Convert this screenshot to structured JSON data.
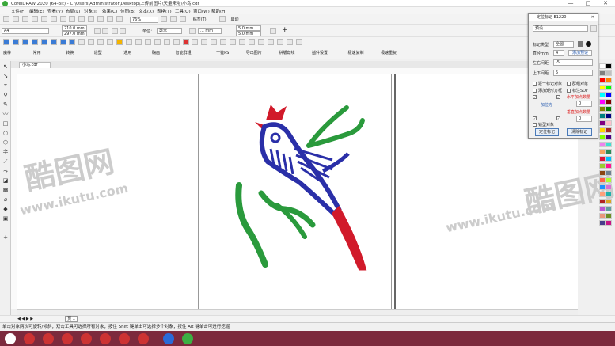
{
  "window": {
    "title": "CorelDRAW 2020 (64-Bit) - C:\\Users\\Administrator\\Desktop\\上传前图片\\矢量来啦\\小鸟.cdr",
    "controls": [
      "—",
      "□",
      "✕"
    ]
  },
  "menu": [
    "文件(F)",
    "编辑(E)",
    "查看(V)",
    "布局(L)",
    "对象(J)",
    "效果(C)",
    "位图(B)",
    "文本(X)",
    "表格(T)",
    "工具(O)",
    "窗口(W)",
    "帮助(H)"
  ],
  "toolbar1": {
    "zoom": "76%",
    "snap_label": "贴齐(T)",
    "launch_label": "启动"
  },
  "toolbar2": {
    "page_size": "A4",
    "width": "210.0 mm",
    "height": "297.0 mm",
    "units_label": "单位：",
    "units": "毫米",
    "nudge": ".1 mm",
    "dup_x": "5.0 mm",
    "dup_y": "5.0 mm"
  },
  "toolbar4": [
    "魔棒",
    "常用",
    "转换",
    "造型",
    "通用",
    "确画",
    "智能群组",
    "一键PS",
    "导出图片",
    "拼版角线",
    "插件设置",
    "极速复制",
    "极速重复"
  ],
  "document_tab": "小鸟.cdr",
  "page_tab": "页 1",
  "status_text": "单击对象两次可旋转/倾斜；双击工具可选择所有对象；按住 Shift 键单击可选择多个对象；按住 Alt 键单击可进行挖掘",
  "dialog": {
    "title": "定位标记 E1220",
    "preset": "预设",
    "mark_type_label": "标记类型",
    "mark_type": "全圆",
    "diameter_label": "直径mm",
    "diameter": "4",
    "add_preset": "添加预设",
    "left_right_label": "左右间距",
    "left_right": "-5",
    "top_bottom_label": "上下间距",
    "top_bottom": "5",
    "opt_single_mark": "逐一标记对象",
    "opt_group_obj": "群组对象",
    "opt_add_border": "添加矩形方框",
    "opt_mark_sdf": "标注SDF",
    "h_add_count": "水平加点数量",
    "pos_dir_label": "加位方",
    "h_value": "0",
    "v_add_count": "垂直加点数量",
    "v_value": "0",
    "opt_lock": "锁型对象",
    "btn_mark": "定位标记",
    "btn_clear": "清除标记"
  },
  "watermark": {
    "cn": "酷图网",
    "url": "www.ikutu.com"
  },
  "colors": {
    "taskbar": "#7c2a3d",
    "bird_blue": "#2a2fa8",
    "bird_red": "#d11a2a",
    "bird_green": "#2a9a3c"
  },
  "palette": [
    "#ffffff",
    "#000000",
    "#7f7f7f",
    "#c0c0c0",
    "#ff0000",
    "#ff7f00",
    "#ffff00",
    "#00ff00",
    "#00ffff",
    "#0000ff",
    "#ff00ff",
    "#800000",
    "#808000",
    "#008000",
    "#008080",
    "#000080",
    "#800080",
    "#ffc0cb",
    "#ffd700",
    "#a52a2a",
    "#7fff00",
    "#4b0082",
    "#ee82ee",
    "#40e0d0",
    "#f4a460",
    "#2e8b57",
    "#dc143c",
    "#00bfff",
    "#9acd32",
    "#ff1493",
    "#8b4513",
    "#708090",
    "#ff6347",
    "#adff2f",
    "#1e90ff",
    "#da70d6",
    "#ffa07a",
    "#20b2aa",
    "#b22222",
    "#daa520",
    "#ba55d3",
    "#5f9ea0",
    "#e9967a",
    "#6b8e23",
    "#483d8b",
    "#c71585"
  ]
}
